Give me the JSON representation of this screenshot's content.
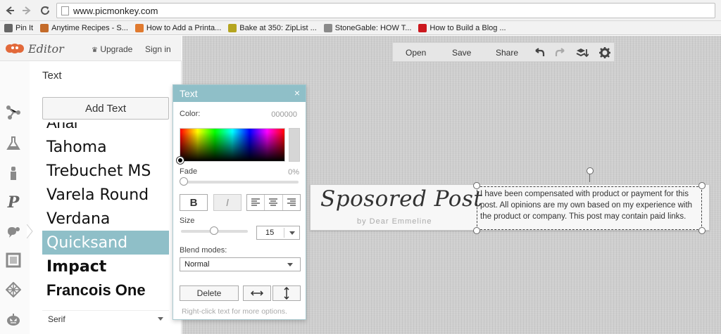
{
  "browser": {
    "url": "www.picmonkey.com",
    "bookmarks": [
      {
        "label": "Pin It",
        "icon": "page-icon",
        "color": "#666666"
      },
      {
        "label": "Anytime Recipes - S...",
        "icon": "recipe-icon",
        "color": "#c46b2a"
      },
      {
        "label": "How to Add a Printa...",
        "icon": "blog-icon",
        "color": "#e07a2f"
      },
      {
        "label": "Bake at 350: ZipList ...",
        "icon": "ziplist-icon",
        "color": "#b5a520"
      },
      {
        "label": "StoneGable: HOW T...",
        "icon": "stonegable-icon",
        "color": "#8a8a8a"
      },
      {
        "label": "How to Build a Blog ...",
        "icon": "youtube-icon",
        "color": "#cc181e"
      }
    ]
  },
  "editor": {
    "title": "Editor",
    "upgrade_label": "Upgrade",
    "signin_label": "Sign in",
    "brand_color": "#e2693a"
  },
  "tools": [
    "basic-edits-icon",
    "effects-icon",
    "touch-up-icon",
    "text-icon",
    "overlays-icon",
    "frames-icon",
    "textures-icon",
    "themes-icon"
  ],
  "panel": {
    "title": "Text",
    "add_text_label": "Add Text",
    "fonts": [
      {
        "name": "Arial",
        "family": "'Liberation Sans', sans-serif",
        "weight": "normal",
        "selected": false
      },
      {
        "name": "Tahoma",
        "family": "'DejaVu Sans', sans-serif",
        "weight": "normal",
        "selected": false
      },
      {
        "name": "Trebuchet MS",
        "family": "'DejaVu Sans', sans-serif",
        "weight": "normal",
        "selected": false
      },
      {
        "name": "Varela Round",
        "family": "'DejaVu Sans', sans-serif",
        "weight": "normal",
        "selected": false
      },
      {
        "name": "Verdana",
        "family": "'DejaVu Sans', sans-serif",
        "weight": "normal",
        "selected": false
      },
      {
        "name": "Quicksand",
        "family": "'DejaVu Sans', sans-serif",
        "weight": "normal",
        "selected": true
      },
      {
        "name": "Impact",
        "family": "'DejaVu Sans', sans-serif",
        "weight": "bold",
        "selected": false
      },
      {
        "name": "Francois One",
        "family": "'Liberation Sans', sans-serif",
        "weight": "bold",
        "selected": false
      }
    ],
    "category": "Serif",
    "accent_color": "#8fbfc8"
  },
  "toolbar": {
    "open_label": "Open",
    "save_label": "Save",
    "share_label": "Share"
  },
  "canvas": {
    "banner_title": "Sposored Post",
    "banner_byline": "by Dear Emmeline",
    "banner_text": "I have been compensated with product or payment for this post. All opinions are my own based on my experience with the product or company. This post may contain paid links."
  },
  "text_dialog": {
    "title": "Text",
    "close_label": "×",
    "color_label": "Color:",
    "color_value": "000000",
    "fade_label": "Fade",
    "fade_value": "0%",
    "bold_label": "B",
    "italic_label": "I",
    "size_label": "Size",
    "size_value": "15",
    "blend_label": "Blend modes:",
    "blend_value": "Normal",
    "delete_label": "Delete",
    "hint": "Right-click text for more options."
  }
}
